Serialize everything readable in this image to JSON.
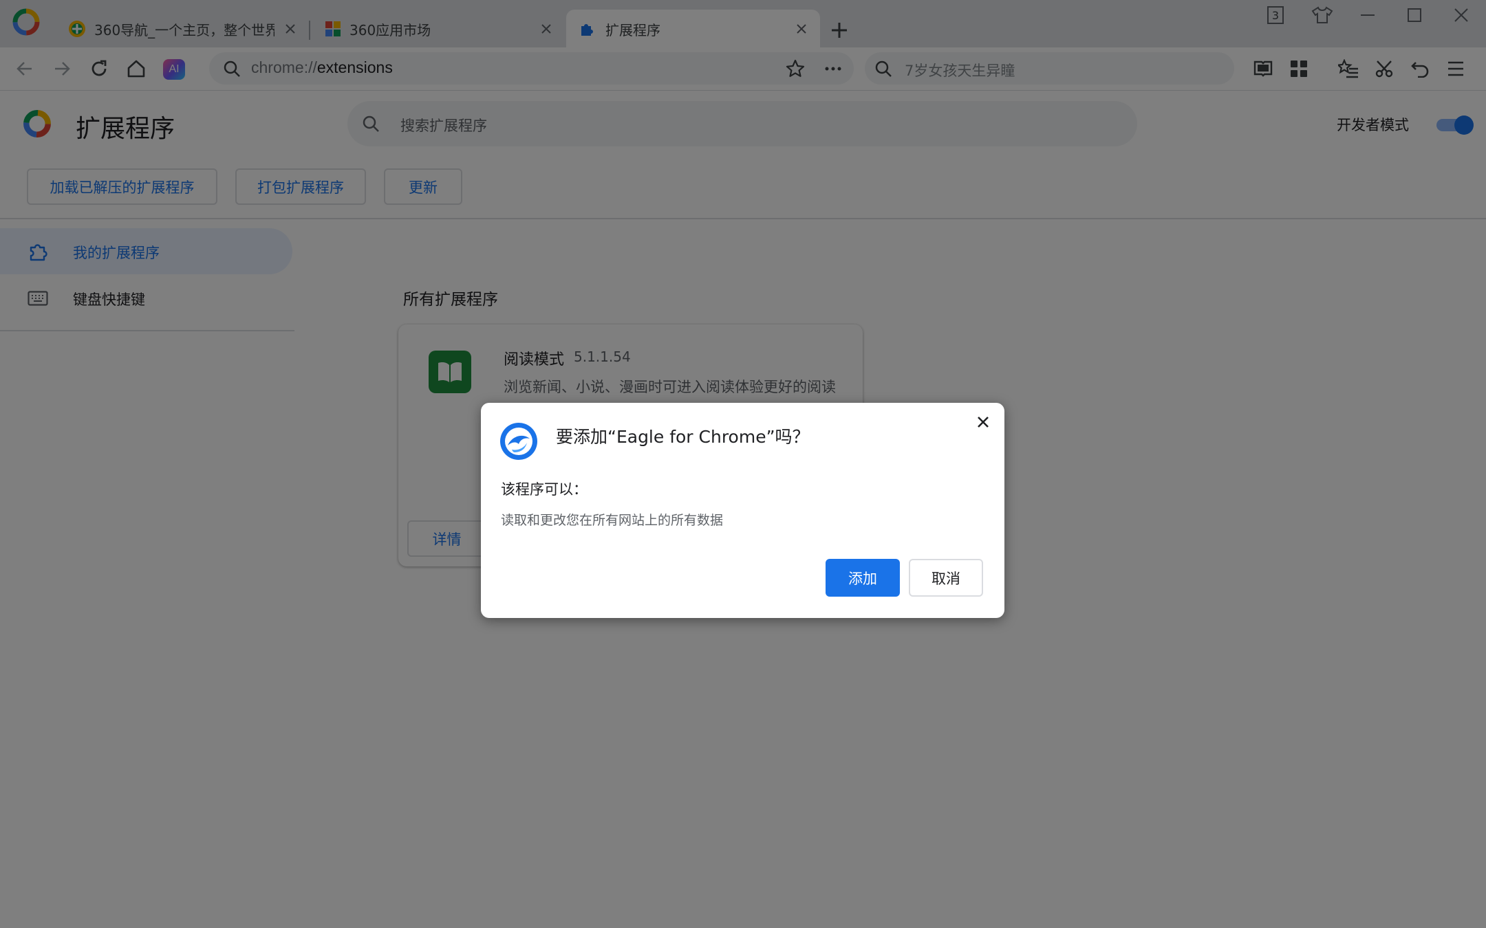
{
  "browser": {
    "tabs": [
      {
        "title": "360导航_一个主页，整个世界",
        "active": false
      },
      {
        "title": "360应用市场",
        "active": false
      },
      {
        "title": "扩展程序",
        "active": true
      }
    ],
    "window_counter": "3",
    "address": {
      "scheme": "chrome://",
      "path": "extensions"
    },
    "search_box": {
      "placeholder": "7岁女孩天生异瞳"
    },
    "ai_label": "AI"
  },
  "extensions_page": {
    "title": "扩展程序",
    "search_placeholder": "搜索扩展程序",
    "developer_mode": {
      "label": "开发者模式",
      "enabled": true
    },
    "actions": {
      "load_unpacked": "加载已解压的扩展程序",
      "pack": "打包扩展程序",
      "update": "更新"
    },
    "sidebar": [
      {
        "label": "我的扩展程序",
        "icon": "puzzle-icon",
        "selected": true
      },
      {
        "label": "键盘快捷键",
        "icon": "keyboard-icon",
        "selected": false
      }
    ],
    "section_title": "所有扩展程序",
    "extension_card": {
      "name": "阅读模式",
      "version": "5.1.1.54",
      "description": "浏览新闻、小说、漫画时可进入阅读体验更好的阅读模式",
      "details_label": "详情"
    }
  },
  "dialog": {
    "title": "要添加“Eagle for Chrome”吗？",
    "subtitle": "该程序可以：",
    "permission": "读取和更改您在所有网站上的所有数据",
    "add_label": "添加",
    "cancel_label": "取消"
  },
  "colors": {
    "accent": "#1a73e8",
    "tab_strip": "#dfe1e5",
    "scrim": "rgba(0,0,0,0.5)",
    "reading_icon": "#1e8e3e"
  }
}
